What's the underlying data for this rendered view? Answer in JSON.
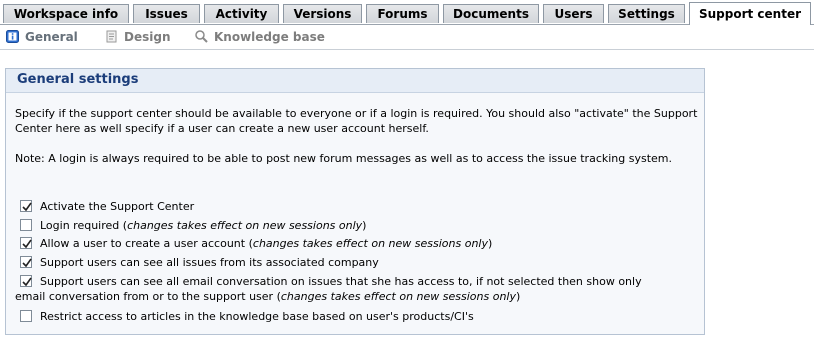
{
  "tabs": [
    {
      "label": "Workspace info",
      "active": false
    },
    {
      "label": "Issues",
      "active": false
    },
    {
      "label": "Activity",
      "active": false
    },
    {
      "label": "Versions",
      "active": false
    },
    {
      "label": "Forums",
      "active": false
    },
    {
      "label": "Documents",
      "active": false
    },
    {
      "label": "Users",
      "active": false
    },
    {
      "label": "Settings",
      "active": false
    },
    {
      "label": "Support center",
      "active": true
    }
  ],
  "subnav": [
    {
      "label": "General",
      "icon": "info-icon",
      "active": true
    },
    {
      "label": "Design",
      "icon": "design-icon",
      "active": false
    },
    {
      "label": "Knowledge base",
      "icon": "knowledge-base-icon",
      "active": false
    }
  ],
  "panel": {
    "title": "General settings",
    "intro": "Specify if the support center should be available to everyone or if a login is required. You should also \"activate\" the Support Center here as well specify if a user can create a new user account herself.",
    "note": "Note: A login is always required to be able to post new forum messages as well as to access the issue tracking system."
  },
  "options": [
    {
      "label": "Activate the Support Center",
      "note": "",
      "checked": true
    },
    {
      "label": "Login required (",
      "note": "changes takes effect on new sessions only",
      "suffix": ")",
      "checked": false
    },
    {
      "label": "Allow a user to create a user account (",
      "note": "changes takes effect on new sessions only",
      "suffix": ")",
      "checked": true
    },
    {
      "label": "Support users can see all issues from its associated company",
      "note": "",
      "checked": true
    },
    {
      "label": "Support users can see all email conversation on issues that she has access to, if not selected then show only",
      "label2": "email conversation from or to the support user (",
      "note": "changes takes effect on new sessions only",
      "suffix": ")",
      "checked": true
    },
    {
      "label": "Restrict access to articles in the knowledge base based on user's products/CI's",
      "note": "",
      "checked": false
    }
  ],
  "colors": {
    "panel_title": "#1b3d7a",
    "panel_bg": "#f6f8fb",
    "panel_head_bg": "#e6edf6"
  }
}
